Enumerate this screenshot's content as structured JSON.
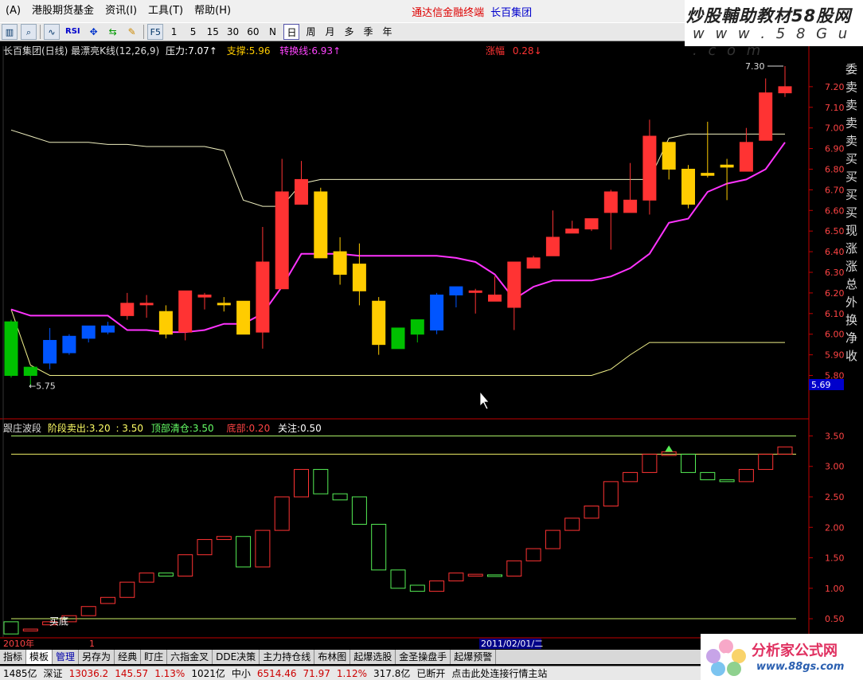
{
  "menu": {
    "items": [
      "(A)",
      "港股期货基金",
      "资讯(I)",
      "工具(T)",
      "帮助(H)"
    ],
    "brand": "通达信金融终端",
    "stock_name": "长百集团"
  },
  "toolbar": {
    "icon_buttons": [
      "candle-icon",
      "zoom-icon",
      "line-chart-icon"
    ],
    "rsi": "RSI",
    "f5": "F5",
    "periods": [
      "1",
      "5",
      "15",
      "30",
      "60",
      "N",
      "日",
      "周",
      "月",
      "多",
      "季",
      "年"
    ],
    "active_period": "日"
  },
  "watermark": {
    "line1": "炒股輔助教材58股网",
    "line2": "w w w . 5 8 G u . c o m"
  },
  "main_info": {
    "title": "长百集团(日线) 最漂亮K线(12,26,9)",
    "pressure_label": "压力:",
    "pressure_value": "7.07↑",
    "support_label": "支撑:",
    "support_value": "5.96",
    "pivot_label": "转换线:",
    "pivot_value": "6.93↑",
    "rise_label": "涨幅",
    "rise_value": "0.28↓"
  },
  "sub_info": {
    "title": "跟庄波段",
    "sell_label": "阶段卖出:",
    "sell_value": "3.20",
    "sell_value2": ": 3.50",
    "top_label": "顶部清仓:",
    "top_value": "3.50",
    "bottom_label": "底部:",
    "bottom_value": "0.20",
    "watch_label": "关注:",
    "watch_value": "0.50"
  },
  "annotations": {
    "high": "7.30",
    "low": "←5.75",
    "buy_bottom": "买底",
    "price_tag": "5.69"
  },
  "right_side_labels": [
    "委",
    "卖",
    "卖",
    "卖",
    "卖",
    "买",
    "买",
    "买",
    "买",
    "现",
    "涨",
    "涨",
    "总",
    "外",
    "换",
    "净",
    "收"
  ],
  "time_axis": {
    "year": "2010年",
    "marker": "1",
    "cursor_date": "2011/02/01/二"
  },
  "tabs": [
    "指标",
    "模板",
    "管理",
    "另存为",
    "经典",
    "盯庄",
    "六指金叉",
    "DDE决策",
    "主力持仓线",
    "布林图",
    "起爆选股",
    "金圣操盘手",
    "起爆预警"
  ],
  "active_tab": "模板",
  "status": [
    "1485亿",
    "深证",
    "13036.2",
    "145.57",
    "1.13%",
    "1021亿",
    "中小",
    "6514.46",
    "71.97",
    "1.12%",
    "317.8亿",
    "已断开",
    "点击此处连接行情主站"
  ],
  "logo": {
    "title": "分析家公式网",
    "url": "www.88gs.com"
  },
  "colors": {
    "up": "#ff3333",
    "down": "#00c000",
    "gold": "#ffcc00",
    "blue": "#0055ff",
    "ma": "#ff33ff",
    "band": "#f0f0c0",
    "axis": "#c00000"
  },
  "chart_data": [
    {
      "type": "candlestick",
      "title": "长百集团(日线) 最漂亮K线(12,26,9)",
      "ylim": [
        5.69,
        7.35
      ],
      "y_ticks": [
        "7.20",
        "7.10",
        "7.00",
        "6.90",
        "6.80",
        "6.70",
        "6.60",
        "6.50",
        "6.40",
        "6.30",
        "6.20",
        "6.10",
        "6.00",
        "5.90",
        "5.80"
      ],
      "candles": [
        {
          "o": 5.8,
          "h": 6.07,
          "l": 5.79,
          "c": 6.06,
          "t": "down"
        },
        {
          "o": 5.8,
          "h": 5.84,
          "l": 5.75,
          "c": 5.84,
          "t": "down"
        },
        {
          "o": 5.86,
          "h": 6.03,
          "l": 5.83,
          "c": 5.97,
          "t": "blue"
        },
        {
          "o": 5.91,
          "h": 6.0,
          "l": 5.9,
          "c": 5.99,
          "t": "blue"
        },
        {
          "o": 5.98,
          "h": 6.04,
          "l": 5.96,
          "c": 6.04,
          "t": "blue"
        },
        {
          "o": 6.01,
          "h": 6.06,
          "l": 6.0,
          "c": 6.04,
          "t": "blue"
        },
        {
          "o": 6.09,
          "h": 6.2,
          "l": 6.07,
          "c": 6.15,
          "t": "up"
        },
        {
          "o": 6.15,
          "h": 6.19,
          "l": 6.08,
          "c": 6.15,
          "t": "up"
        },
        {
          "o": 6.11,
          "h": 6.14,
          "l": 5.98,
          "c": 6.0,
          "t": "gold"
        },
        {
          "o": 6.01,
          "h": 6.21,
          "l": 5.97,
          "c": 6.21,
          "t": "up"
        },
        {
          "o": 6.19,
          "h": 6.2,
          "l": 6.12,
          "c": 6.18,
          "t": "up"
        },
        {
          "o": 6.15,
          "h": 6.18,
          "l": 6.11,
          "c": 6.15,
          "t": "gold"
        },
        {
          "o": 6.16,
          "h": 6.16,
          "l": 6.0,
          "c": 6.0,
          "t": "gold"
        },
        {
          "o": 6.01,
          "h": 6.52,
          "l": 5.93,
          "c": 6.35,
          "t": "up"
        },
        {
          "o": 6.22,
          "h": 6.85,
          "l": 6.22,
          "c": 6.69,
          "t": "up"
        },
        {
          "o": 6.63,
          "h": 6.84,
          "l": 6.63,
          "c": 6.75,
          "t": "up"
        },
        {
          "o": 6.69,
          "h": 6.71,
          "l": 6.37,
          "c": 6.37,
          "t": "gold"
        },
        {
          "o": 6.4,
          "h": 6.47,
          "l": 6.24,
          "c": 6.29,
          "t": "gold"
        },
        {
          "o": 6.34,
          "h": 6.44,
          "l": 6.14,
          "c": 6.21,
          "t": "gold"
        },
        {
          "o": 6.16,
          "h": 6.18,
          "l": 5.9,
          "c": 5.95,
          "t": "gold"
        },
        {
          "o": 5.93,
          "h": 6.03,
          "l": 5.93,
          "c": 6.03,
          "t": "down"
        },
        {
          "o": 6.0,
          "h": 6.07,
          "l": 5.96,
          "c": 6.07,
          "t": "down"
        },
        {
          "o": 6.02,
          "h": 6.2,
          "l": 6.0,
          "c": 6.19,
          "t": "blue"
        },
        {
          "o": 6.19,
          "h": 6.23,
          "l": 6.13,
          "c": 6.23,
          "t": "blue"
        },
        {
          "o": 6.21,
          "h": 6.22,
          "l": 6.1,
          "c": 6.21,
          "t": "up"
        },
        {
          "o": 6.16,
          "h": 6.28,
          "l": 6.16,
          "c": 6.19,
          "t": "up"
        },
        {
          "o": 6.13,
          "h": 6.35,
          "l": 6.02,
          "c": 6.35,
          "t": "up"
        },
        {
          "o": 6.32,
          "h": 6.38,
          "l": 6.32,
          "c": 6.37,
          "t": "up"
        },
        {
          "o": 6.38,
          "h": 6.6,
          "l": 6.38,
          "c": 6.47,
          "t": "up"
        },
        {
          "o": 6.49,
          "h": 6.55,
          "l": 6.49,
          "c": 6.51,
          "t": "up"
        },
        {
          "o": 6.51,
          "h": 6.55,
          "l": 6.5,
          "c": 6.56,
          "t": "up"
        },
        {
          "o": 6.59,
          "h": 6.7,
          "l": 6.41,
          "c": 6.69,
          "t": "up"
        },
        {
          "o": 6.59,
          "h": 6.83,
          "l": 6.59,
          "c": 6.65,
          "t": "up"
        },
        {
          "o": 6.65,
          "h": 7.04,
          "l": 6.58,
          "c": 6.96,
          "t": "up"
        },
        {
          "o": 6.93,
          "h": 6.93,
          "l": 6.75,
          "c": 6.8,
          "t": "gold"
        },
        {
          "o": 6.8,
          "h": 6.82,
          "l": 6.61,
          "c": 6.63,
          "t": "gold"
        },
        {
          "o": 6.78,
          "h": 7.03,
          "l": 6.76,
          "c": 6.77,
          "t": "gold"
        },
        {
          "o": 6.82,
          "h": 6.85,
          "l": 6.65,
          "c": 6.81,
          "t": "gold"
        },
        {
          "o": 6.79,
          "h": 7.0,
          "l": 6.79,
          "c": 6.93,
          "t": "up"
        },
        {
          "o": 6.94,
          "h": 7.24,
          "l": 6.94,
          "c": 7.17,
          "t": "up"
        },
        {
          "o": 7.17,
          "h": 7.3,
          "l": 7.15,
          "c": 7.2,
          "t": "up"
        }
      ],
      "ma_line": [
        6.12,
        6.09,
        6.09,
        6.09,
        6.09,
        6.09,
        6.02,
        6.02,
        6.01,
        6.01,
        6.02,
        6.05,
        6.05,
        6.1,
        6.23,
        6.39,
        6.39,
        6.39,
        6.38,
        6.38,
        6.38,
        6.38,
        6.38,
        6.37,
        6.35,
        6.29,
        6.17,
        6.23,
        6.26,
        6.26,
        6.26,
        6.28,
        6.32,
        6.39,
        6.54,
        6.56,
        6.69,
        6.73,
        6.75,
        6.8,
        6.93
      ],
      "upper_band": [
        6.99,
        6.96,
        6.93,
        6.93,
        6.93,
        6.92,
        6.92,
        6.91,
        6.91,
        6.91,
        6.91,
        6.89,
        6.65,
        6.62,
        6.62,
        6.73,
        6.75,
        6.75,
        6.75,
        6.75,
        6.75,
        6.75,
        6.75,
        6.75,
        6.75,
        6.75,
        6.75,
        6.75,
        6.75,
        6.75,
        6.75,
        6.75,
        6.75,
        6.75,
        6.95,
        6.97,
        6.97,
        6.97,
        6.97,
        6.97,
        6.97
      ],
      "lower_band": [
        6.12,
        5.85,
        5.8,
        5.8,
        5.8,
        5.8,
        5.8,
        5.8,
        5.8,
        5.8,
        5.8,
        5.8,
        5.8,
        5.8,
        5.8,
        5.8,
        5.8,
        5.8,
        5.8,
        5.8,
        5.8,
        5.8,
        5.8,
        5.8,
        5.8,
        5.8,
        5.8,
        5.8,
        5.8,
        5.8,
        5.8,
        5.83,
        5.9,
        5.96,
        5.96,
        5.96,
        5.96,
        5.96,
        5.96,
        5.96,
        5.96
      ]
    },
    {
      "type": "box-oscillator",
      "title": "跟庄波段",
      "ylim": [
        0.2,
        3.65
      ],
      "y_ticks": [
        "3.50",
        "3.00",
        "2.50",
        "2.00",
        "1.50",
        "1.00",
        "0.50"
      ],
      "hlines": [
        3.5,
        3.2,
        0.5
      ],
      "boxes": [
        {
          "a": 0.25,
          "b": 0.45,
          "t": "down"
        },
        {
          "a": 0.3,
          "b": 0.33,
          "t": "up"
        },
        {
          "a": 0.4,
          "b": 0.45,
          "t": "up"
        },
        {
          "a": 0.45,
          "b": 0.55,
          "t": "up"
        },
        {
          "a": 0.55,
          "b": 0.7,
          "t": "up"
        },
        {
          "a": 0.75,
          "b": 0.85,
          "t": "up"
        },
        {
          "a": 0.85,
          "b": 1.1,
          "t": "up"
        },
        {
          "a": 1.1,
          "b": 1.25,
          "t": "up"
        },
        {
          "a": 1.2,
          "b": 1.25,
          "t": "down"
        },
        {
          "a": 1.2,
          "b": 1.55,
          "t": "up"
        },
        {
          "a": 1.55,
          "b": 1.8,
          "t": "up"
        },
        {
          "a": 1.8,
          "b": 1.85,
          "t": "up"
        },
        {
          "a": 1.35,
          "b": 1.85,
          "t": "down"
        },
        {
          "a": 1.35,
          "b": 1.95,
          "t": "up"
        },
        {
          "a": 1.95,
          "b": 2.5,
          "t": "up"
        },
        {
          "a": 2.5,
          "b": 2.95,
          "t": "up"
        },
        {
          "a": 2.55,
          "b": 2.95,
          "t": "down"
        },
        {
          "a": 2.45,
          "b": 2.55,
          "t": "down"
        },
        {
          "a": 2.05,
          "b": 2.5,
          "t": "down"
        },
        {
          "a": 1.3,
          "b": 2.05,
          "t": "down"
        },
        {
          "a": 1.0,
          "b": 1.3,
          "t": "down"
        },
        {
          "a": 0.95,
          "b": 1.05,
          "t": "down"
        },
        {
          "a": 0.95,
          "b": 1.12,
          "t": "up"
        },
        {
          "a": 1.12,
          "b": 1.25,
          "t": "up"
        },
        {
          "a": 1.2,
          "b": 1.23,
          "t": "up"
        },
        {
          "a": 1.2,
          "b": 1.22,
          "t": "down"
        },
        {
          "a": 1.2,
          "b": 1.45,
          "t": "up"
        },
        {
          "a": 1.45,
          "b": 1.65,
          "t": "up"
        },
        {
          "a": 1.65,
          "b": 1.95,
          "t": "up"
        },
        {
          "a": 1.95,
          "b": 2.15,
          "t": "up"
        },
        {
          "a": 2.15,
          "b": 2.35,
          "t": "up"
        },
        {
          "a": 2.35,
          "b": 2.75,
          "t": "up"
        },
        {
          "a": 2.75,
          "b": 2.9,
          "t": "up"
        },
        {
          "a": 2.9,
          "b": 3.2,
          "t": "up"
        },
        {
          "a": 3.18,
          "b": 3.24,
          "t": "up"
        },
        {
          "a": 2.9,
          "b": 3.2,
          "t": "down"
        },
        {
          "a": 2.78,
          "b": 2.9,
          "t": "down"
        },
        {
          "a": 2.75,
          "b": 2.78,
          "t": "down"
        },
        {
          "a": 2.75,
          "b": 2.95,
          "t": "up"
        },
        {
          "a": 2.95,
          "b": 3.2,
          "t": "up"
        },
        {
          "a": 3.2,
          "b": 3.32,
          "t": "up"
        }
      ]
    }
  ]
}
